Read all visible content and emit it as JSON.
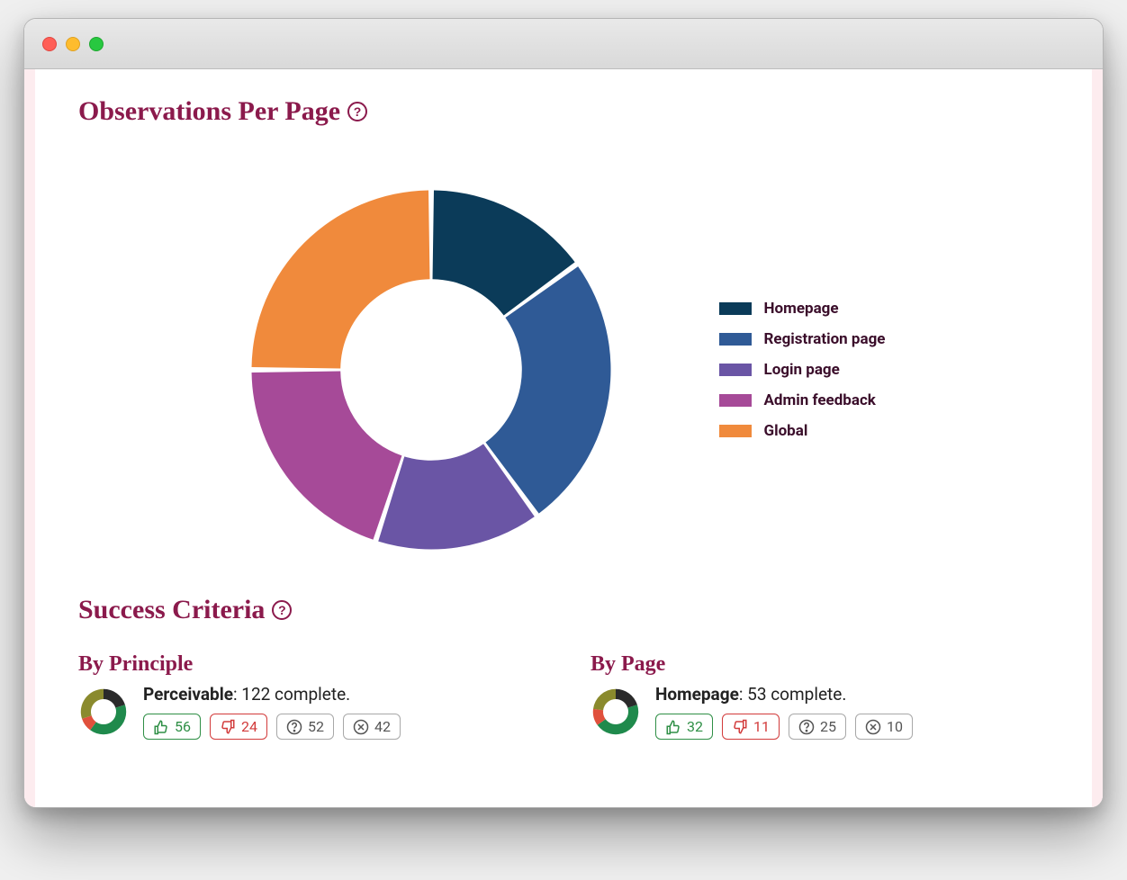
{
  "sections": {
    "observations_title": "Observations Per Page",
    "success_title": "Success Criteria",
    "by_principle_title": "By Principle",
    "by_page_title": "By Page"
  },
  "chart_data": {
    "type": "pie",
    "title": "Observations Per Page",
    "series": [
      {
        "name": "Homepage",
        "value": 15,
        "color": "#0b3b59"
      },
      {
        "name": "Registration page",
        "value": 25,
        "color": "#2f5a96"
      },
      {
        "name": "Login page",
        "value": 15,
        "color": "#6a55a5"
      },
      {
        "name": "Admin feedback",
        "value": 20,
        "color": "#a64a98"
      },
      {
        "name": "Global",
        "value": 25,
        "color": "#f08a3c"
      }
    ],
    "inner_radius_ratio": 0.5
  },
  "legend": [
    {
      "label": "Homepage",
      "color": "#0b3b59"
    },
    {
      "label": "Registration page",
      "color": "#2f5a96"
    },
    {
      "label": "Login page",
      "color": "#6a55a5"
    },
    {
      "label": "Admin feedback",
      "color": "#a64a98"
    },
    {
      "label": "Global",
      "color": "#f08a3c"
    }
  ],
  "by_principle": {
    "name": "Perceivable",
    "complete_text": ": 122 complete.",
    "stats": {
      "pass": 56,
      "fail": 24,
      "review": 52,
      "na": 42
    },
    "mini": [
      {
        "color": "#2a2a2a",
        "value": 20
      },
      {
        "color": "#1f8a4c",
        "value": 40
      },
      {
        "color": "#e0503c",
        "value": 10
      },
      {
        "color": "#8a8a2d",
        "value": 30
      }
    ]
  },
  "by_page": {
    "name": "Homepage",
    "complete_text": ": 53 complete.",
    "stats": {
      "pass": 32,
      "fail": 11,
      "review": 25,
      "na": 10
    },
    "mini": [
      {
        "color": "#2a2a2a",
        "value": 20
      },
      {
        "color": "#1f8a4c",
        "value": 45
      },
      {
        "color": "#e0503c",
        "value": 12
      },
      {
        "color": "#8a8a2d",
        "value": 23
      }
    ]
  }
}
